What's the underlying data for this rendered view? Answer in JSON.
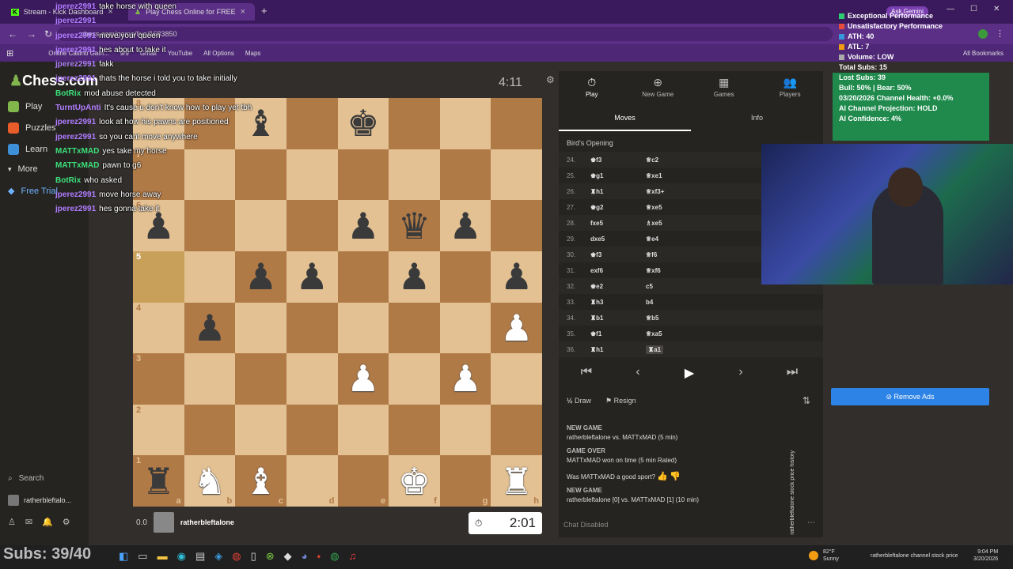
{
  "browser": {
    "tabs": [
      {
        "label": "Stream - Kick Dashboard",
        "active": false
      },
      {
        "label": "Play Chess Online for FREE",
        "active": true
      }
    ],
    "url": "chess.com/game/live/1683850",
    "bookmarks": [
      "Online Casino Gam...",
      "9/9",
      "Gmail",
      "YouTube",
      "All Options",
      "Maps"
    ],
    "all_bookmarks": "All Bookmarks",
    "ask_gemini": "Ask Gemini"
  },
  "nav": {
    "logo": "Chess.com",
    "items": [
      "Play",
      "Puzzles",
      "Learn",
      "More",
      "Free Trial"
    ],
    "search": "Search",
    "user": "ratherbleftalo..."
  },
  "board": {
    "top_clock": "4:11",
    "rows": [
      [
        "",
        "",
        "bB",
        "",
        "bK",
        "",
        "",
        ""
      ],
      [
        "",
        "",
        "",
        "",
        "",
        "",
        "",
        ""
      ],
      [
        "bP",
        "",
        "",
        "",
        "bP",
        "bQ",
        "bP",
        ""
      ],
      [
        "",
        "",
        "bP",
        "bP",
        "",
        "bP",
        "",
        "bP"
      ],
      [
        "",
        "bP",
        "",
        "",
        "",
        "",
        "",
        "wP"
      ],
      [
        "",
        "",
        "",
        "",
        "wP",
        "",
        "wP",
        ""
      ],
      [
        "",
        "",
        "",
        "",
        "",
        "",
        "",
        ""
      ],
      [
        "bR",
        "wN",
        "wB",
        "",
        "",
        "wK",
        "",
        "wR"
      ]
    ],
    "ranks": [
      "8",
      "7",
      "6",
      "5",
      "4",
      "3",
      "2",
      "1"
    ],
    "files": [
      "a",
      "b",
      "c",
      "d",
      "e",
      "f",
      "g",
      "h"
    ],
    "highlight": [
      [
        3,
        0
      ]
    ],
    "bottom_player": {
      "score": "0.0",
      "name": "ratherbleftalone",
      "clock": "2:01"
    }
  },
  "panel": {
    "tabs": [
      {
        "label": "Play",
        "icon": "stopwatch-icon"
      },
      {
        "label": "New Game",
        "icon": "plus-icon"
      },
      {
        "label": "Games",
        "icon": "grid-icon"
      },
      {
        "label": "Players",
        "icon": "people-icon"
      }
    ],
    "subtabs": [
      "Moves",
      "Info"
    ],
    "opening": "Bird's Opening",
    "moves": [
      {
        "n": "24.",
        "w": "♚f3",
        "b": "♕c2"
      },
      {
        "n": "25.",
        "w": "♚g1",
        "b": "♕xe1"
      },
      {
        "n": "26.",
        "w": "♜h1",
        "b": "♕xf3+"
      },
      {
        "n": "27.",
        "w": "♚g2",
        "b": "♕xe5"
      },
      {
        "n": "28.",
        "w": "fxe5",
        "b": "♗xe5"
      },
      {
        "n": "29.",
        "w": "dxe5",
        "b": "♕e4"
      },
      {
        "n": "30.",
        "w": "♚f3",
        "b": "♕f6"
      },
      {
        "n": "31.",
        "w": "exf6",
        "b": "♕xf6"
      },
      {
        "n": "32.",
        "w": "♚e2",
        "b": "c5"
      },
      {
        "n": "33.",
        "w": "♜h3",
        "b": "b4"
      },
      {
        "n": "34.",
        "w": "♜b1",
        "b": "♕b5"
      },
      {
        "n": "35.",
        "w": "♚f1",
        "b": "♕xa5"
      },
      {
        "n": "36.",
        "w": "♜h1",
        "b": "♜a1"
      }
    ],
    "draw": "Draw",
    "resign": "Resign",
    "log": [
      {
        "h": "NEW GAME",
        "t": "ratherbleftalone vs. MATTxMAD (5 min)"
      },
      {
        "h": "GAME OVER",
        "t": "MATTxMAD won on time (5 min Rated)"
      },
      {
        "h": "",
        "t": "Was MATTxMAD a good sport?"
      },
      {
        "h": "NEW GAME",
        "t": "ratherbleftalone [0] vs. MATTxMAD [1] (10 min)"
      }
    ],
    "chat": "Chat Disabled"
  },
  "stream_chat": [
    {
      "u": "jperez2991",
      "m": "take horse with queen",
      "g": false
    },
    {
      "u": "jperez2991",
      "m": "",
      "g": false
    },
    {
      "u": "jperez2991",
      "m": "move your queen",
      "g": false
    },
    {
      "u": "jperez2991",
      "m": "hes about to take it",
      "g": false
    },
    {
      "u": "jperez2991",
      "m": "fakk",
      "g": false
    },
    {
      "u": "jperez2991",
      "m": "thats the horse i told you to take initially",
      "g": false
    },
    {
      "u": "BotRix",
      "m": "mod abuse detected",
      "g": true
    },
    {
      "u": "TurntUpAnti",
      "m": "It's cause u don't know how to play yet tbh",
      "g": false
    },
    {
      "u": "jperez2991",
      "m": "look at how his pawns are positioned",
      "g": false
    },
    {
      "u": "jperez2991",
      "m": "so you cant move anywhere",
      "g": false
    },
    {
      "u": "MATTxMAD",
      "m": "yes take my horse",
      "g": true
    },
    {
      "u": "MATTxMAD",
      "m": "pawn to g6",
      "g": true
    },
    {
      "u": "BotRix",
      "m": "who asked",
      "g": true
    },
    {
      "u": "jperez2991",
      "m": "move horse away",
      "g": false
    },
    {
      "u": "jperez2991",
      "m": "hes gonna take it",
      "g": false
    }
  ],
  "stats": [
    {
      "t": "Exceptional Performance",
      "c": "#2ecc71"
    },
    {
      "t": "Unsatisfactory Performance",
      "c": "#e74c3c"
    },
    {
      "t": "ATH: 40",
      "c": "#3498db"
    },
    {
      "t": "ATL: 7",
      "c": "#f39c12"
    },
    {
      "t": "Volume: LOW",
      "c": "#aaaaaa"
    },
    {
      "t": "Total Subs: 15",
      "c": ""
    },
    {
      "t": "Lost Subs: 39",
      "c": ""
    },
    {
      "t": "Bull: 50% | Bear: 50%",
      "c": ""
    },
    {
      "t": "03/20/2026 Channel Health: +0.0%",
      "c": ""
    },
    {
      "t": "AI Channel Projection: HOLD",
      "c": ""
    },
    {
      "t": "AI Confidence: 4%",
      "c": ""
    }
  ],
  "remove_ads": "Remove Ads",
  "vertical_text": "ratherbleftalone stock price history",
  "taskbar": {
    "subs": "Subs: 39/40",
    "weather_temp": "82°F",
    "weather": "Sunny",
    "tray_text": "ratherbleftalone channel stock price",
    "time": "9:04 PM",
    "date": "3/20/2026"
  }
}
